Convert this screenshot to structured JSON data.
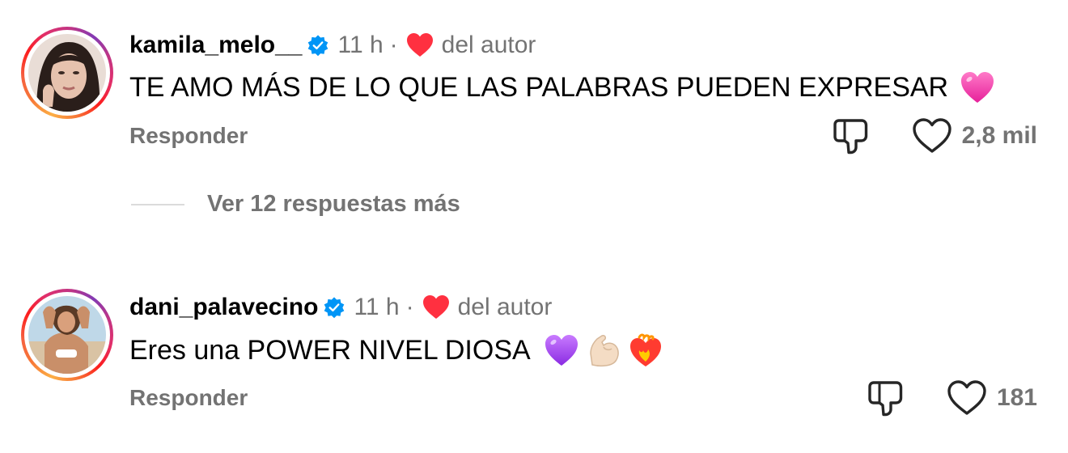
{
  "comments": [
    {
      "username": "kamila_melo__",
      "verified": true,
      "time": "11 h",
      "separator": "·",
      "author_badge": "del autor",
      "text": "TE AMO MÁS DE LO QUE LAS PALABRAS PUEDEN EXPRESAR",
      "emojis": [
        "pink-heart-icon"
      ],
      "reply_label": "Responder",
      "like_count": "2,8 mil"
    },
    {
      "username": "dani_palavecino",
      "verified": true,
      "time": "11 h",
      "separator": "·",
      "author_badge": "del autor",
      "text": "Eres una POWER NIVEL DIOSA",
      "emojis": [
        "purple-heart-icon",
        "flexed-biceps-icon",
        "heart-on-fire-icon"
      ],
      "reply_label": "Responder",
      "like_count": "181"
    }
  ],
  "more_replies_label": "Ver 12 respuestas más",
  "colors": {
    "secondary_text": "#737373",
    "verified_blue": "#0095f6",
    "author_heart": "#ff3040",
    "divider": "#dbdbdb"
  }
}
